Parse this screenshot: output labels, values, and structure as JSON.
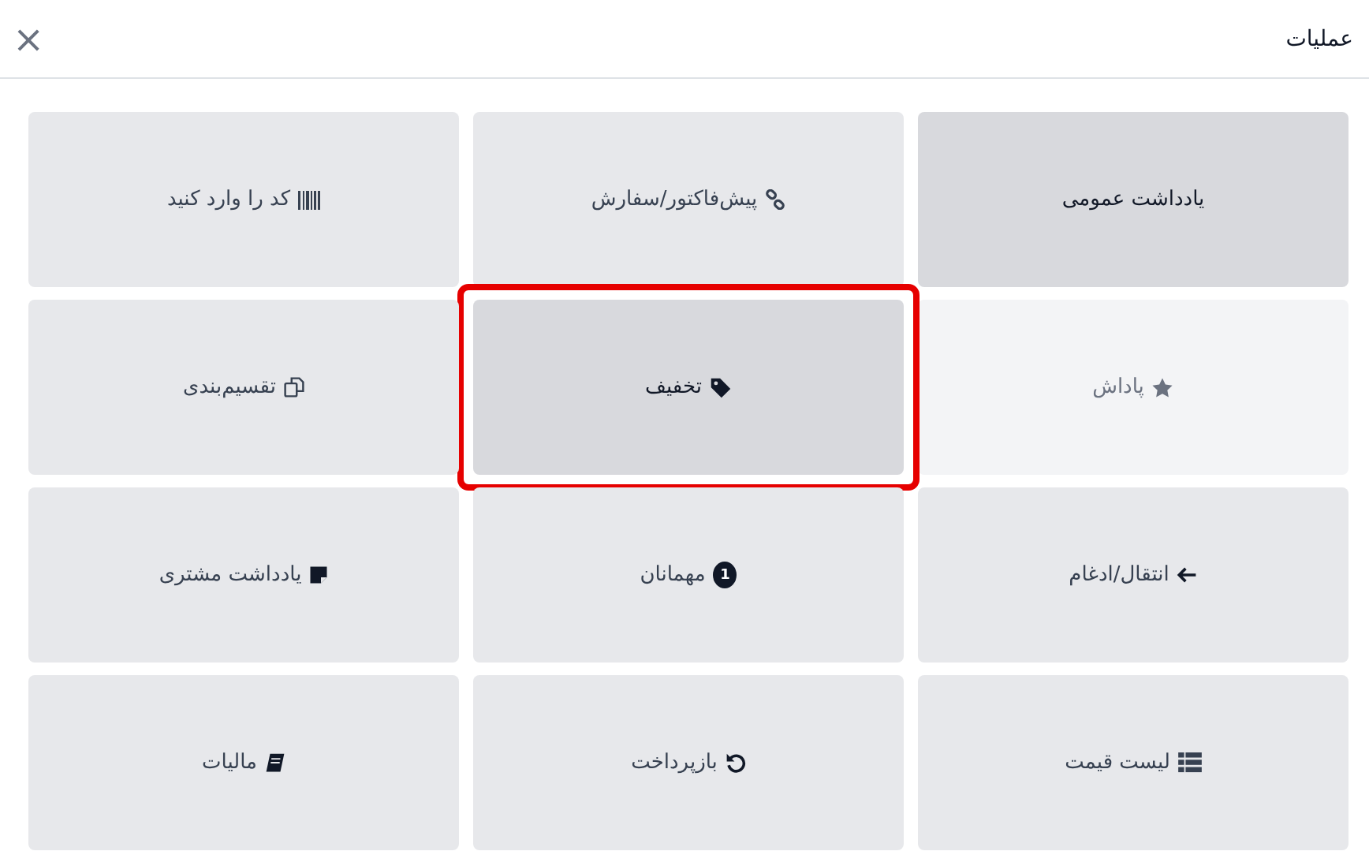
{
  "dialog": {
    "title": "عملیات",
    "close": "×"
  },
  "actions": [
    {
      "label": "یادداشت عمومی",
      "active": true,
      "disabled": false,
      "highlighted": false
    },
    {
      "label": "پیش‌فاکتور/سفارش",
      "active": false,
      "disabled": false,
      "highlighted": false
    },
    {
      "label": "کد را وارد کنید",
      "active": false,
      "disabled": false,
      "highlighted": false
    },
    {
      "label": "پاداش",
      "active": false,
      "disabled": true,
      "highlighted": false
    },
    {
      "label": "تخفیف",
      "active": true,
      "disabled": false,
      "highlighted": true
    },
    {
      "label": "تقسیم‌بندی",
      "active": false,
      "disabled": false,
      "highlighted": false
    },
    {
      "label": "انتقال/ادغام",
      "active": false,
      "disabled": false,
      "highlighted": false
    },
    {
      "label": "مهمانان",
      "badge": "1",
      "active": false,
      "disabled": false,
      "highlighted": false
    },
    {
      "label": "یادداشت مشتری",
      "active": false,
      "disabled": false,
      "highlighted": false
    },
    {
      "label": "لیست قیمت",
      "active": false,
      "disabled": false,
      "highlighted": false
    },
    {
      "label": "بازپرداخت",
      "active": false,
      "disabled": false,
      "highlighted": false
    },
    {
      "label": "مالیات",
      "active": false,
      "disabled": false,
      "highlighted": false
    }
  ]
}
